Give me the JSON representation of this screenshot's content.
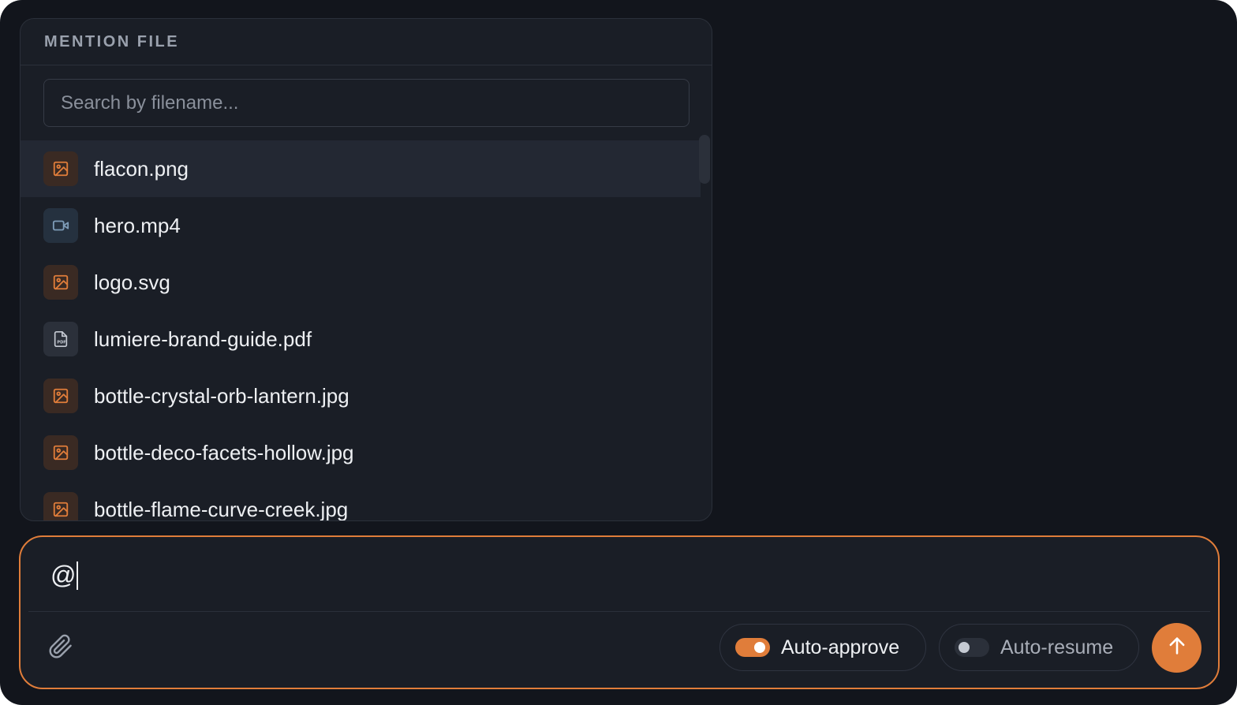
{
  "mention_popup": {
    "title": "MENTION FILE",
    "search_placeholder": "Search by filename...",
    "files": [
      {
        "name": "flacon.png",
        "icon": "image-icon",
        "selected": true
      },
      {
        "name": "hero.mp4",
        "icon": "video-icon",
        "selected": false
      },
      {
        "name": "logo.svg",
        "icon": "image-icon",
        "selected": false
      },
      {
        "name": "lumiere-brand-guide.pdf",
        "icon": "pdf-file-icon",
        "selected": false
      },
      {
        "name": "bottle-crystal-orb-lantern.jpg",
        "icon": "image-icon",
        "selected": false
      },
      {
        "name": "bottle-deco-facets-hollow.jpg",
        "icon": "image-icon",
        "selected": false
      },
      {
        "name": "bottle-flame-curve-creek.jpg",
        "icon": "image-icon",
        "selected": false
      }
    ]
  },
  "composer": {
    "input_value": "@",
    "attach_icon": "paperclip-icon",
    "auto_approve": {
      "label": "Auto-approve",
      "enabled": true
    },
    "auto_resume": {
      "label": "Auto-resume",
      "enabled": false
    },
    "send_icon": "arrow-up-icon"
  },
  "colors": {
    "accent": "#e07d3a",
    "background": "#12151c",
    "panel": "#1a1e26"
  }
}
